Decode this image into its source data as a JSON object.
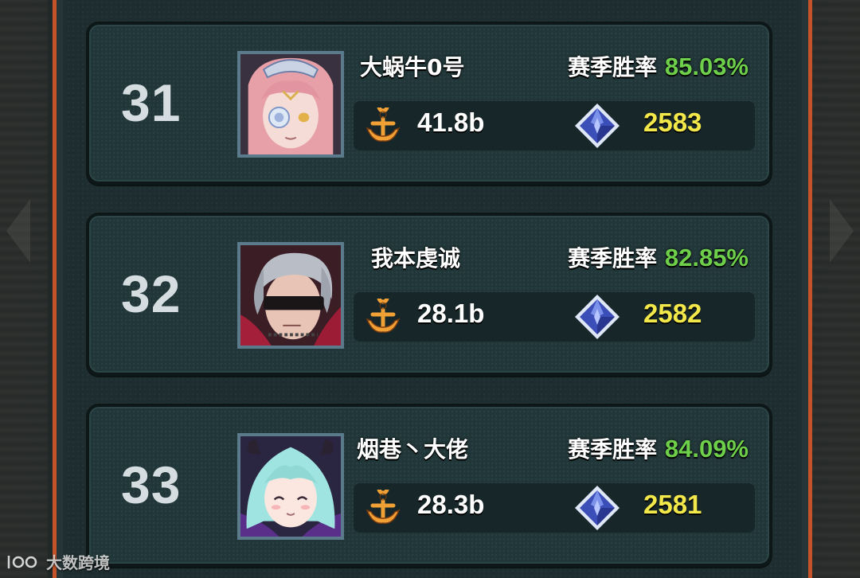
{
  "leaderboard": {
    "entries": [
      {
        "rank": "31",
        "name": "大蜗牛0号",
        "winrate_label": "赛季胜率",
        "winrate": "85.03%",
        "power": "41.8b",
        "score": "2583",
        "avatar": "pink-hair-flower-eyepatch"
      },
      {
        "rank": "32",
        "name": "我本虔诚",
        "winrate_label": "赛季胜率",
        "winrate": "82.85%",
        "power": "28.1b",
        "score": "2582",
        "avatar": "silver-hair-blindfold"
      },
      {
        "rank": "33",
        "name": "烟巷丶大佬",
        "winrate_label": "赛季胜率",
        "winrate": "84.09%",
        "power": "28.3b",
        "score": "2581",
        "avatar": "cyan-hair-horns"
      }
    ]
  },
  "icons": {
    "power": "anchor-icon",
    "score": "blue-crystal-icon"
  },
  "colors": {
    "winrate": "#6ecf4a",
    "score": "#f2e84a",
    "frame": "#c4532a"
  },
  "watermark": {
    "text": "大数跨境"
  }
}
